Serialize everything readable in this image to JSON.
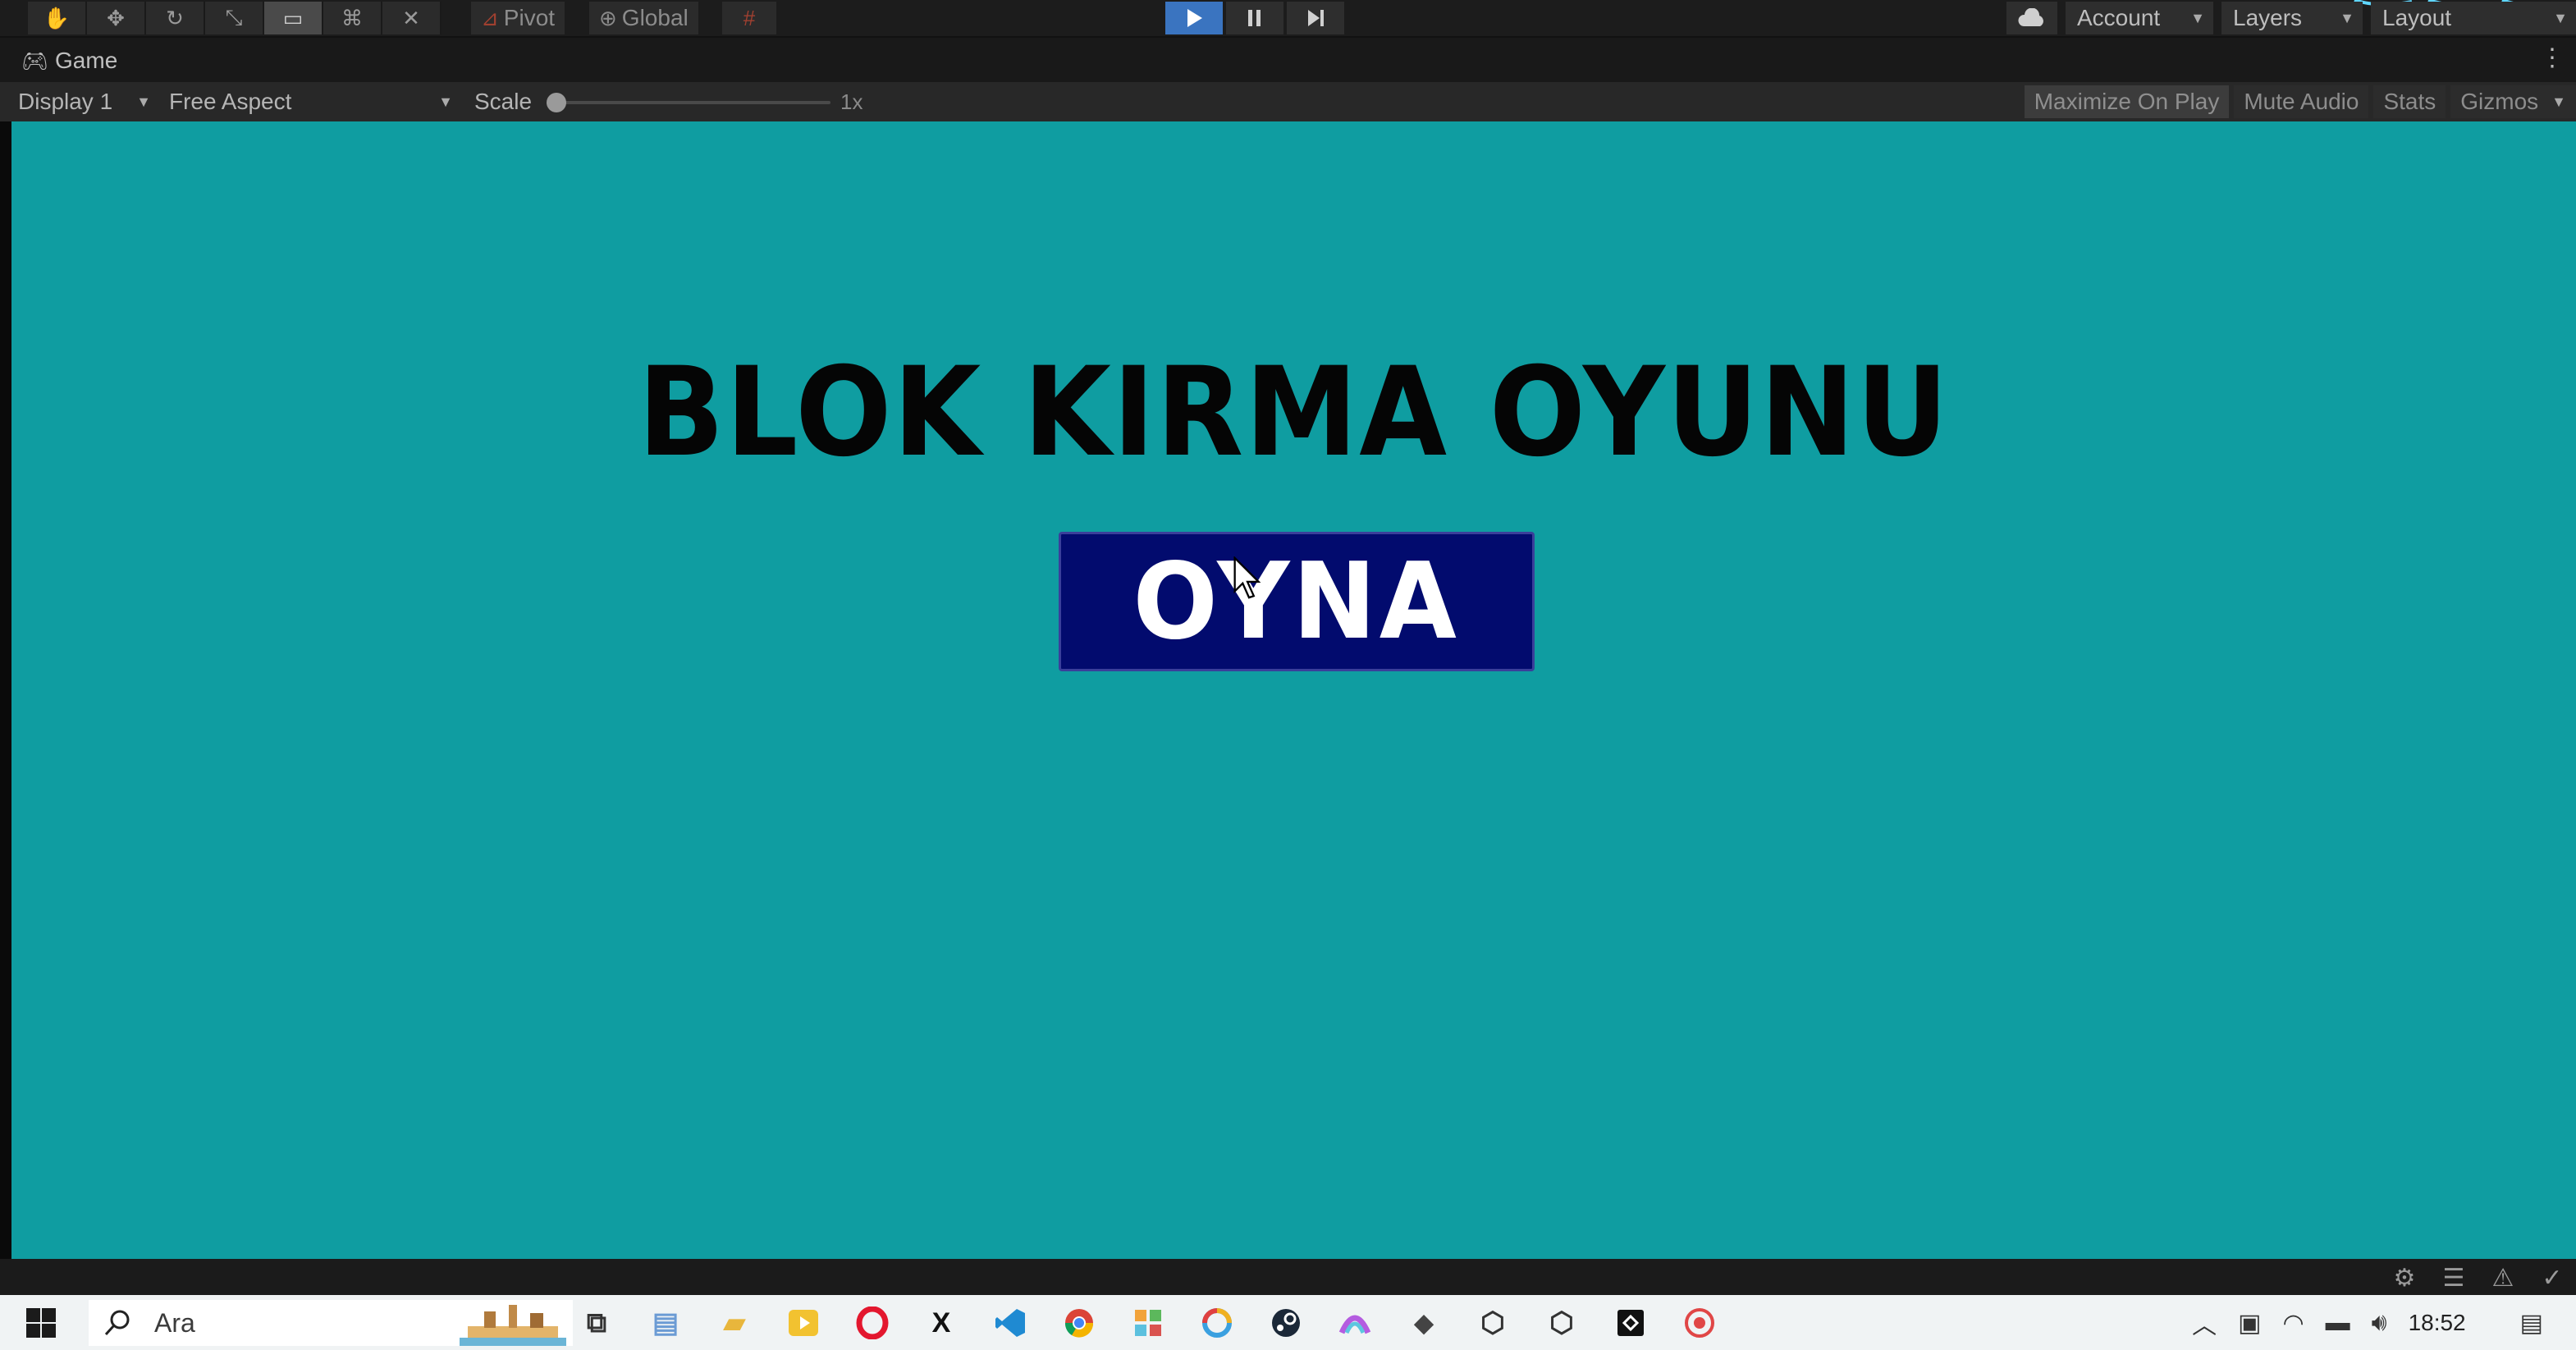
{
  "toolbar": {
    "pivot_label": "Pivot",
    "global_label": "Global",
    "account_label": "Account",
    "layers_label": "Layers",
    "layout_label": "Layout"
  },
  "tab": {
    "title": "Game"
  },
  "game_options": {
    "display": "Display 1",
    "aspect": "Free Aspect",
    "scale_label": "Scale",
    "scale_value": "1x",
    "scale_level": 0,
    "maximize_on_play": "Maximize On Play",
    "mute_audio": "Mute Audio",
    "stats": "Stats",
    "gizmos": "Gizmos"
  },
  "game": {
    "title": "BLOK KIRMA OYUNU",
    "play_button": "OYNA",
    "background_color": "#0f9da1",
    "button_color": "#020b6e"
  },
  "taskbar": {
    "search_placeholder": "Ara",
    "clock": "18:52",
    "apps": [
      "task-view-icon",
      "notepad-icon",
      "file-explorer-icon",
      "media-player-icon",
      "opera-icon",
      "x-icon",
      "vscode-icon",
      "chrome-icon",
      "paint-icon",
      "color-wheel-icon",
      "steam-icon",
      "arc-icon",
      "box-icon",
      "unity-hub-icon",
      "unity-icon",
      "unity-editor-icon",
      "recorder-icon"
    ]
  }
}
